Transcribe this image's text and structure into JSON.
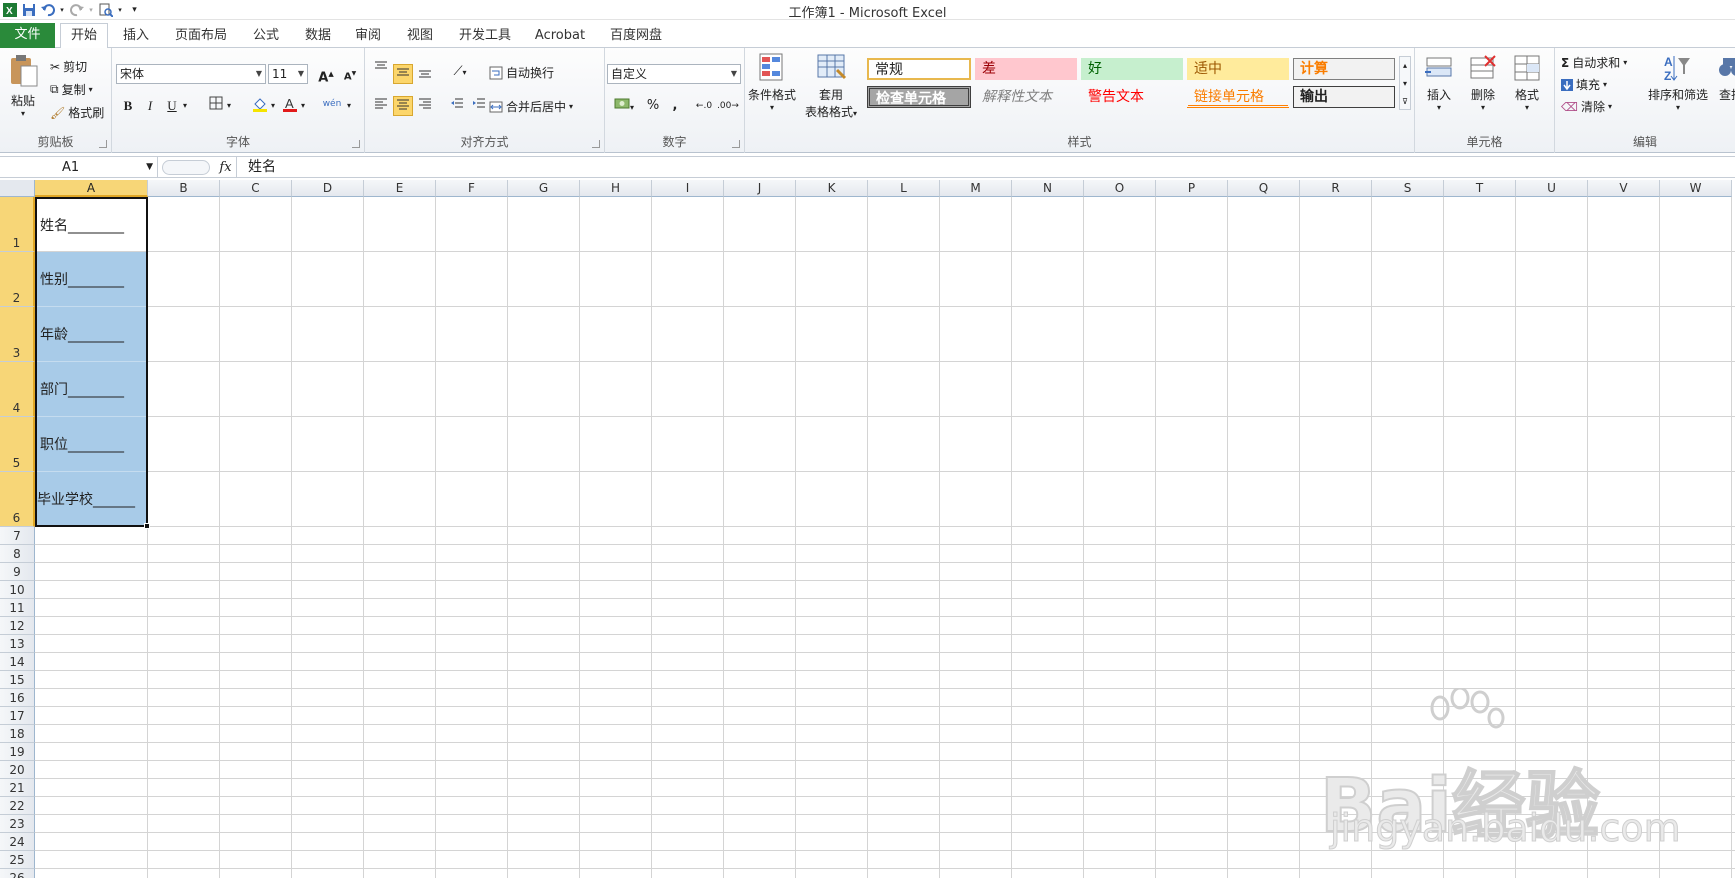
{
  "window": {
    "title": "工作簿1 - Microsoft Excel"
  },
  "tabs": [
    "文件",
    "开始",
    "插入",
    "页面布局",
    "公式",
    "数据",
    "审阅",
    "视图",
    "开发工具",
    "Acrobat",
    "百度网盘"
  ],
  "clipboard": {
    "paste": "粘贴",
    "cut": "剪切",
    "copy": "复制",
    "format_painter": "格式刷",
    "label": "剪贴板"
  },
  "font": {
    "name": "宋体",
    "size": "11",
    "bold": "B",
    "italic": "I",
    "underline": "U",
    "label": "字体",
    "grow": "A",
    "shrink": "A",
    "wen": "wén"
  },
  "alignment": {
    "wrap": "自动换行",
    "merge": "合并后居中",
    "label": "对齐方式"
  },
  "number": {
    "format": "自定义",
    "percent": "%",
    "comma": ",",
    "label": "数字"
  },
  "styles": {
    "conditional": "条件格式",
    "table_format_1": "套用",
    "table_format_2": "表格格式",
    "cells": {
      "normal": "常规",
      "bad": "差",
      "good": "好",
      "neutral": "适中",
      "calc": "计算",
      "check": "检查单元格",
      "explanatory": "解释性文本",
      "warning": "警告文本",
      "linked": "链接单元格",
      "output": "输出"
    },
    "label": "样式"
  },
  "cells_group": {
    "insert": "插入",
    "delete": "删除",
    "format": "格式",
    "label": "单元格"
  },
  "editing": {
    "autosum": "自动求和",
    "fill": "填充",
    "clear": "清除",
    "sort": "排序和筛选",
    "find": "查找",
    "label": "编辑"
  },
  "formula_bar": {
    "name_box": "A1",
    "fx": "fx",
    "content": "姓名"
  },
  "columns": [
    "A",
    "B",
    "C",
    "D",
    "E",
    "F",
    "G",
    "H",
    "I",
    "J",
    "K",
    "L",
    "M",
    "N",
    "O",
    "P",
    "Q",
    "R",
    "S",
    "T",
    "U",
    "V",
    "W"
  ],
  "rows": [
    "1",
    "2",
    "3",
    "4",
    "5",
    "6",
    "7",
    "8",
    "9",
    "10",
    "11",
    "12",
    "13",
    "14",
    "15",
    "16",
    "17",
    "18",
    "19",
    "20",
    "21",
    "22",
    "23",
    "24",
    "25",
    "26"
  ],
  "cells": [
    "姓名________",
    "性别________",
    "年龄________",
    "部门________",
    "职位________",
    "毕业学校______"
  ],
  "watermark": {
    "brand": "Bai经验",
    "url": "jingyan.baidu.com"
  },
  "colors": {
    "file_tab": "#2a8a3a",
    "selection_fill": "#a8cbe8",
    "header_selected": "#f7d677"
  }
}
